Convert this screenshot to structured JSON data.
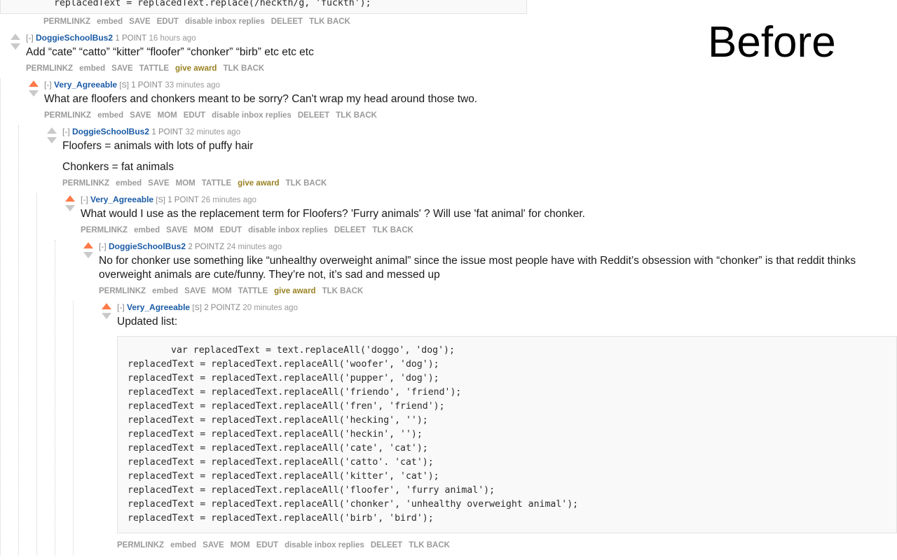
{
  "watermark": {
    "label": "Before"
  },
  "labels": {
    "collapse": "[-]",
    "submitter": "[S]"
  },
  "action_sets": {
    "full_edut": [
      "PERMLINKZ",
      "embed",
      "SAVE",
      "EDUT",
      "disable inbox replies",
      "DELEET",
      "TLK BACK"
    ],
    "mod_edut": [
      "PERMLINKZ",
      "embed",
      "SAVE",
      "MOM",
      "EDUT",
      "disable inbox replies",
      "DELEET",
      "TLK BACK"
    ],
    "tattle": [
      "PERMLINKZ",
      "embed",
      "SAVE",
      "TATTLE",
      "give award",
      "TLK BACK"
    ],
    "mod_tattle": [
      "PERMLINKZ",
      "embed",
      "SAVE",
      "MOM",
      "TATTLE",
      "give award",
      "TLK BACK"
    ]
  },
  "top_clipped_code": "replacedText = replacedText.replace(/heckth/g, 'fuckth');",
  "top_actions": [
    "PERMLINKZ",
    "embed",
    "SAVE",
    "EDUT",
    "disable inbox replies",
    "DELEET",
    "TLK BACK"
  ],
  "comments": [
    {
      "author": "DoggieSchoolBus2",
      "is_submitter": false,
      "score": "1 POINT",
      "age": "16 hours ago",
      "upvoted": false,
      "body": [
        "Add “cate” “catto” “kitter” “floofer” “chonker” “birb” etc etc etc"
      ],
      "actions": [
        "PERMLINKZ",
        "embed",
        "SAVE",
        "TATTLE",
        "give award",
        "TLK BACK"
      ]
    },
    {
      "author": "Very_Agreeable",
      "is_submitter": true,
      "score": "1 POINT",
      "age": "33 minutes ago",
      "upvoted": true,
      "body": [
        "What are floofers and chonkers meant to be sorry? Can't wrap my head around those two."
      ],
      "actions": [
        "PERMLINKZ",
        "embed",
        "SAVE",
        "MOM",
        "EDUT",
        "disable inbox replies",
        "DELEET",
        "TLK BACK"
      ]
    },
    {
      "author": "DoggieSchoolBus2",
      "is_submitter": false,
      "score": "1 POINT",
      "age": "32 minutes ago",
      "upvoted": false,
      "body": [
        "Floofers = animals with lots of puffy hair",
        "Chonkers = fat animals"
      ],
      "actions": [
        "PERMLINKZ",
        "embed",
        "SAVE",
        "MOM",
        "TATTLE",
        "give award",
        "TLK BACK"
      ]
    },
    {
      "author": "Very_Agreeable",
      "is_submitter": true,
      "score": "1 POINT",
      "age": "26 minutes ago",
      "upvoted": true,
      "body": [
        "What would I use as the replacement term for Floofers? 'Furry animals' ? Will use 'fat animal' for chonker."
      ],
      "actions": [
        "PERMLINKZ",
        "embed",
        "SAVE",
        "MOM",
        "EDUT",
        "disable inbox replies",
        "DELEET",
        "TLK BACK"
      ]
    },
    {
      "author": "DoggieSchoolBus2",
      "is_submitter": false,
      "score": "2 POINTZ",
      "age": "24 minutes ago",
      "upvoted": true,
      "body": [
        "No for chonker use something like “unhealthy overweight animal” since the issue most people have with Reddit’s obsession with “chonker” is that reddit thinks overweight animals are cute/funny. They’re not, it’s sad and messed up"
      ],
      "actions": [
        "PERMLINKZ",
        "embed",
        "SAVE",
        "MOM",
        "TATTLE",
        "give award",
        "TLK BACK"
      ]
    },
    {
      "author": "Very_Agreeable",
      "is_submitter": true,
      "score": "2 POINTZ",
      "age": "20 minutes ago",
      "upvoted": true,
      "body": [
        "Updated list:"
      ],
      "code": "var replacedText = text.replaceAll('doggo', 'dog');\nreplacedText = replacedText.replaceAll('woofer', 'dog');\nreplacedText = replacedText.replaceAll('pupper', 'dog');\nreplacedText = replacedText.replaceAll('friendo', 'friend');\nreplacedText = replacedText.replaceAll('fren', 'friend');\nreplacedText = replacedText.replaceAll('hecking', '');\nreplacedText = replacedText.replaceAll('heckin', '');\nreplacedText = replacedText.replaceAll('cate', 'cat');\nreplacedText = replacedText.replaceAll('catto'. 'cat');\nreplacedText = replacedText.replaceAll('kitter', 'cat');\nreplacedText = replacedText.replaceAll('floofer', 'furry animal');\nreplacedText = replacedText.replaceAll('chonker', 'unhealthy overweight animal');\nreplacedText = replacedText.replaceAll('birb', 'bird');",
      "actions": [
        "PERMLINKZ",
        "embed",
        "SAVE",
        "MOM",
        "EDUT",
        "disable inbox replies",
        "DELEET",
        "TLK BACK"
      ]
    }
  ],
  "colors": {
    "upvote_active": "#ff7a48",
    "arrow_inactive": "#c9c9c9",
    "author_link": "#1a5ba6",
    "action_link": "#9a9a9a",
    "give_award": "#998222",
    "code_bg": "#f9f9f9",
    "thread_line": "#cfcfcf"
  }
}
